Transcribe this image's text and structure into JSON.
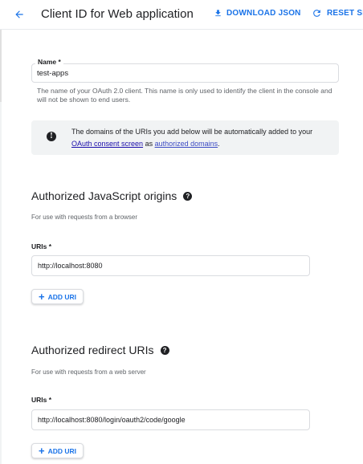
{
  "header": {
    "title": "Client ID for Web application",
    "download_label": "DOWNLOAD JSON",
    "reset_label": "RESET SEC"
  },
  "name_field": {
    "label": "Name *",
    "value": "test-apps",
    "help": "The name of your OAuth 2.0 client. This name is only used to identify the client in the console and will not be shown to end users."
  },
  "info": {
    "text_before": "The domains of the URIs you add below will be automatically added to your ",
    "link1": "OAuth consent screen",
    "text_mid": " as ",
    "link2": "authorized domains",
    "text_after": "."
  },
  "js_origins": {
    "title": "Authorized JavaScript origins",
    "subtitle": "For use with requests from a browser",
    "uris_label": "URIs *",
    "uri_value": "http://localhost:8080",
    "add_label": "ADD URI"
  },
  "redirect_uris": {
    "title": "Authorized redirect URIs",
    "subtitle": "For use with requests from a web server",
    "uris_label": "URIs *",
    "uri_value": "http://localhost:8080/login/oauth2/code/google",
    "add_label": "ADD URI"
  },
  "colors": {
    "accent": "#1a73e8",
    "info_bg": "#f1f3f4"
  }
}
